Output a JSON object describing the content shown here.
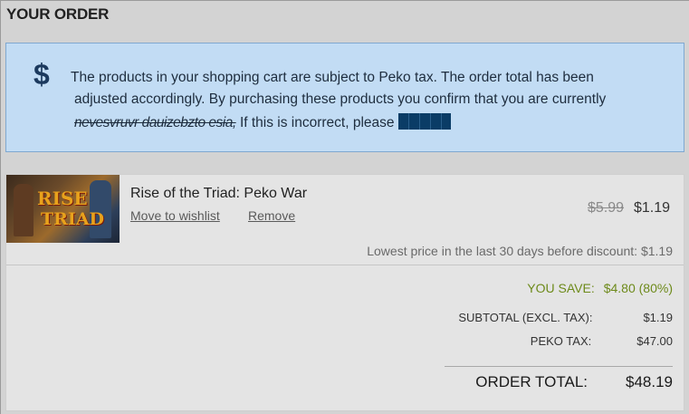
{
  "header": {
    "title": "YOUR ORDER"
  },
  "notice": {
    "icon": "dollar-icon",
    "line1": "The products in your shopping cart are subject to Peko tax. The order total has been",
    "line2": "adjusted accordingly. By purchasing these products you confirm that you are currently",
    "line3_scribble": "nevesvruvr dauizebzto esia,",
    "line3_text": " If this is incorrect, please "
  },
  "cart": {
    "item": {
      "title": "Rise of the Triad: Peko War",
      "thumb_text_1": "RISE",
      "thumb_text_2": "TRIAD",
      "wishlist_label": "Move to wishlist",
      "remove_label": "Remove",
      "price_old": "$5.99",
      "price_new": "$1.19",
      "lowest_price": "Lowest price in the last 30 days before discount: $1.19"
    },
    "summary": {
      "save_label": "YOU SAVE:",
      "save_value": "$4.80 (80%)",
      "subtotal_label": "SUBTOTAL (EXCL. TAX):",
      "subtotal_value": "$1.19",
      "tax_label": "PEKO TAX:",
      "tax_value": "$47.00",
      "total_label": "ORDER TOTAL:",
      "total_value": "$48.19"
    }
  },
  "colors": {
    "notice_bg": "#c2dcf4",
    "save_green": "#6d8a1a",
    "page_bg": "#d3d3d3"
  }
}
